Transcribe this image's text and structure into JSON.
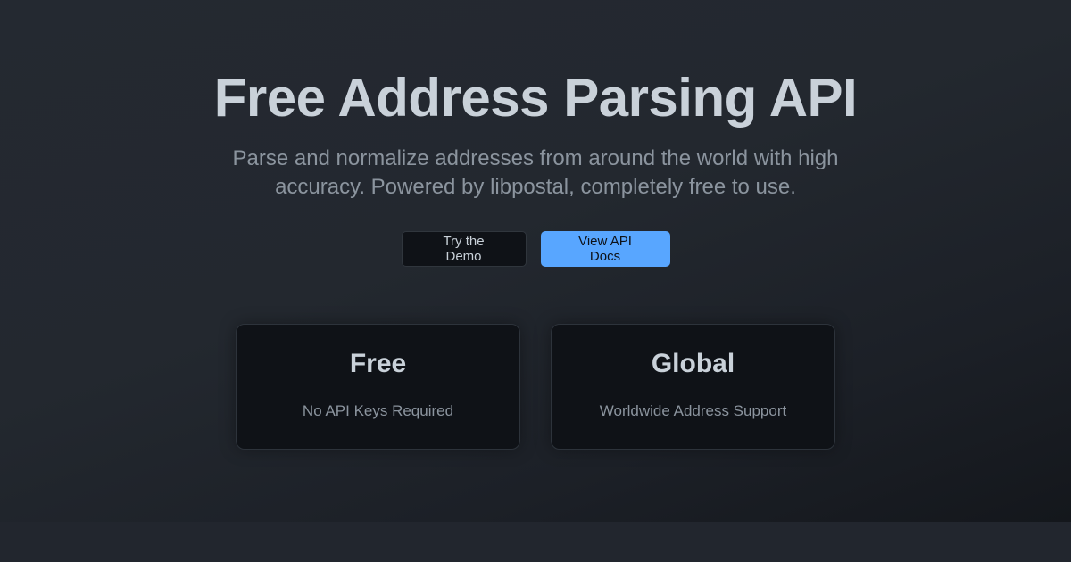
{
  "hero": {
    "title": "Free Address Parsing API",
    "subtitle": "Parse and normalize addresses from around the world with high accuracy. Powered by libpostal, completely free to use."
  },
  "actions": {
    "demo_label": "Try the Demo",
    "docs_label": "View API Docs"
  },
  "features": [
    {
      "title": "Free",
      "description": "No API Keys Required"
    },
    {
      "title": "Global",
      "description": "Worldwide Address Support"
    }
  ],
  "colors": {
    "accent": "#58a6ff",
    "heading": "#c9d1d9",
    "muted": "#8b949e",
    "card_background": "#0f1217"
  }
}
